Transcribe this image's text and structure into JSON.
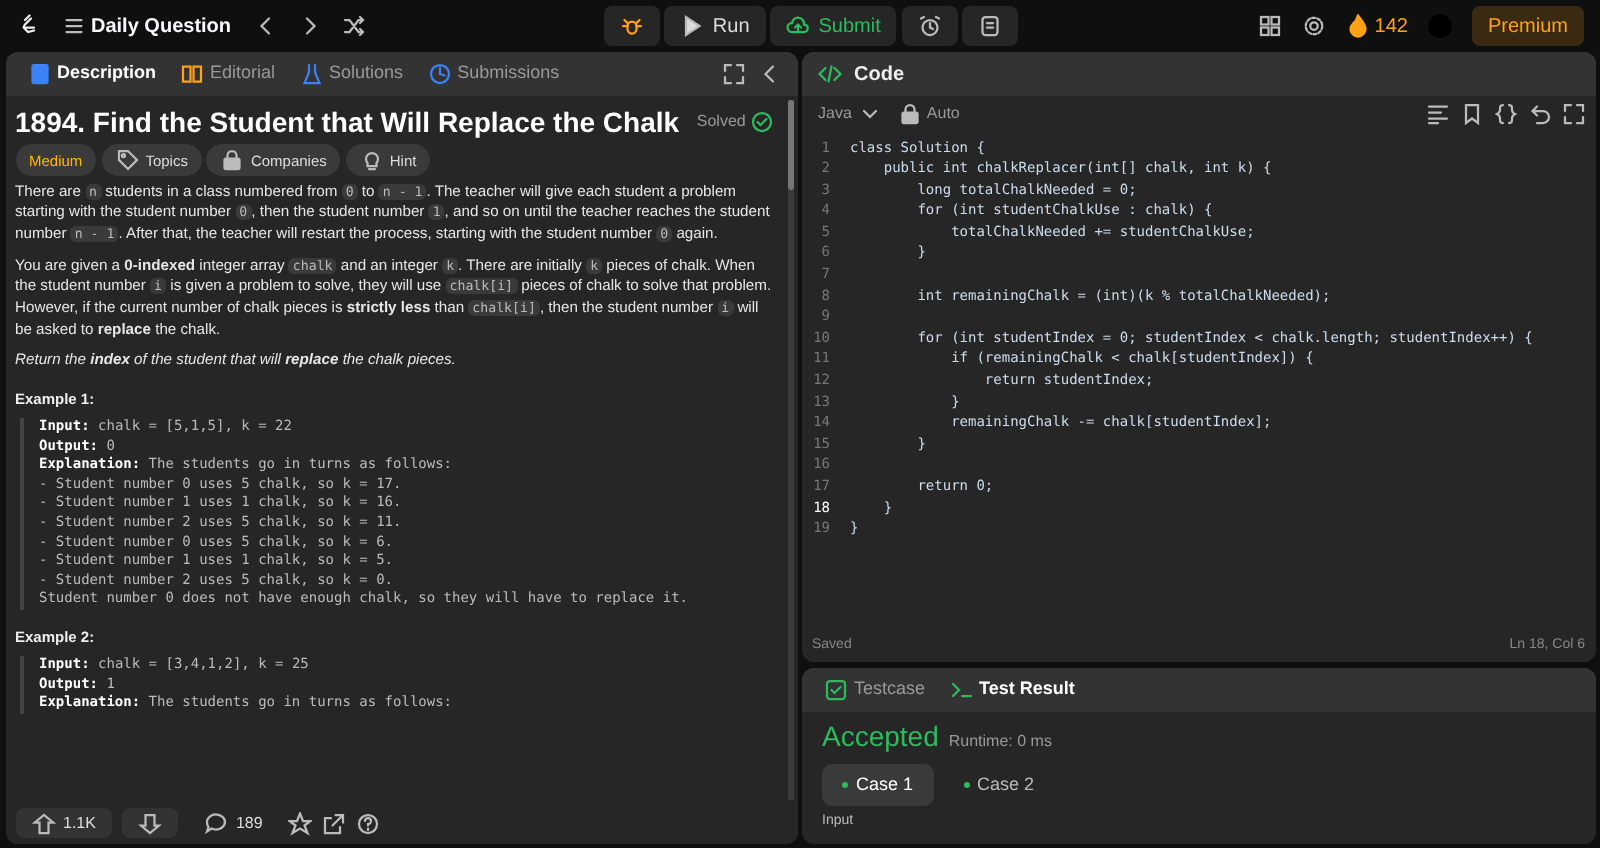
{
  "topbar": {
    "problem_list": "Daily Question",
    "run": "Run",
    "submit": "Submit",
    "streak": "142",
    "premium": "Premium"
  },
  "description_panel": {
    "tabs": [
      {
        "label": "Description",
        "selected": true
      },
      {
        "label": "Editorial",
        "selected": false
      },
      {
        "label": "Solutions",
        "selected": false
      },
      {
        "label": "Submissions",
        "selected": false
      }
    ],
    "title": "1894. Find the Student that Will Replace the Chalk",
    "status": "Solved",
    "tags": [
      {
        "label": "Medium",
        "kind": "difficulty"
      },
      {
        "label": "Topics",
        "kind": "topics"
      },
      {
        "label": "Companies",
        "kind": "companies"
      },
      {
        "label": "Hint",
        "kind": "hint"
      }
    ],
    "paragraphs": [
      [
        {
          "kind": "text",
          "text": "There are "
        },
        {
          "kind": "code",
          "text": "n"
        },
        {
          "kind": "text",
          "text": " students in a class numbered from "
        },
        {
          "kind": "code",
          "text": "0"
        },
        {
          "kind": "text",
          "text": " to "
        },
        {
          "kind": "code",
          "text": "n - 1"
        },
        {
          "kind": "text",
          "text": ". The teacher will give each student a problem starting with the student number "
        },
        {
          "kind": "code",
          "text": "0"
        },
        {
          "kind": "text",
          "text": ", then the student number "
        },
        {
          "kind": "code",
          "text": "1"
        },
        {
          "kind": "text",
          "text": ", and so on until the teacher reaches the student number "
        },
        {
          "kind": "code",
          "text": "n - 1"
        },
        {
          "kind": "text",
          "text": ". After that, the teacher will restart the process, starting with the student number "
        },
        {
          "kind": "code",
          "text": "0"
        },
        {
          "kind": "text",
          "text": " again."
        }
      ],
      [
        {
          "kind": "text",
          "text": "You are given a "
        },
        {
          "kind": "bold",
          "text": "0-indexed"
        },
        {
          "kind": "text",
          "text": " integer array "
        },
        {
          "kind": "code",
          "text": "chalk"
        },
        {
          "kind": "text",
          "text": " and an integer "
        },
        {
          "kind": "code",
          "text": "k"
        },
        {
          "kind": "text",
          "text": ". There are initially "
        },
        {
          "kind": "code",
          "text": "k"
        },
        {
          "kind": "text",
          "text": " pieces of chalk. When the student number "
        },
        {
          "kind": "code",
          "text": "i"
        },
        {
          "kind": "text",
          "text": " is given a problem to solve, they will use "
        },
        {
          "kind": "code",
          "text": "chalk[i]"
        },
        {
          "kind": "text",
          "text": " pieces of chalk to solve that problem. However, if the current number of chalk pieces is "
        },
        {
          "kind": "bold",
          "text": "strictly less"
        },
        {
          "kind": "text",
          "text": " than "
        },
        {
          "kind": "code",
          "text": "chalk[i]"
        },
        {
          "kind": "text",
          "text": ", then the student number "
        },
        {
          "kind": "code",
          "text": "i"
        },
        {
          "kind": "text",
          "text": " will be asked to "
        },
        {
          "kind": "bold",
          "text": "replace"
        },
        {
          "kind": "text",
          "text": " the chalk."
        }
      ],
      [
        {
          "kind": "italic",
          "text": "Return the "
        },
        {
          "kind": "bolditalic",
          "text": "index"
        },
        {
          "kind": "italic",
          "text": " of the student that will "
        },
        {
          "kind": "bolditalic",
          "text": "replace"
        },
        {
          "kind": "italic",
          "text": " the chalk pieces."
        }
      ]
    ],
    "examples": [
      {
        "heading": "Example 1:",
        "lines": [
          "**Input:** chalk = [5,1,5], k = 22",
          "**Output:** 0",
          "**Explanation:** The students go in turns as follows:",
          "- Student number 0 uses 5 chalk, so k = 17.",
          "- Student number 1 uses 1 chalk, so k = 16.",
          "- Student number 2 uses 5 chalk, so k = 11.",
          "- Student number 0 uses 5 chalk, so k = 6.",
          "- Student number 1 uses 1 chalk, so k = 5.",
          "- Student number 2 uses 5 chalk, so k = 0.",
          "Student number 0 does not have enough chalk, so they will have to replace it."
        ]
      },
      {
        "heading": "Example 2:",
        "lines": [
          "**Input:** chalk = [3,4,1,2], k = 25",
          "**Output:** 1",
          "**Explanation:** The students go in turns as follows:"
        ]
      }
    ],
    "footer": {
      "likes": "1.1K",
      "comments": "189"
    }
  },
  "code_panel": {
    "title": "Code",
    "language": "Java",
    "mode": "Auto",
    "lines": [
      {
        "number": "1",
        "text": "class Solution {",
        "current": false
      },
      {
        "number": "2",
        "text": "    public int chalkReplacer(int[] chalk, int k) {",
        "current": false
      },
      {
        "number": "3",
        "text": "        long totalChalkNeeded = 0;",
        "current": false
      },
      {
        "number": "4",
        "text": "        for (int studentChalkUse : chalk) {",
        "current": false
      },
      {
        "number": "5",
        "text": "            totalChalkNeeded += studentChalkUse;",
        "current": false
      },
      {
        "number": "6",
        "text": "        }",
        "current": false
      },
      {
        "number": "7",
        "current": false
      },
      {
        "number": "8",
        "text": "        int remainingChalk = (int)(k % totalChalkNeeded);",
        "current": false
      },
      {
        "number": "9",
        "current": false
      },
      {
        "number": "10",
        "text": "        for (int studentIndex = 0; studentIndex < chalk.length; studentIndex++) {",
        "current": false
      },
      {
        "number": "11",
        "text": "            if (remainingChalk < chalk[studentIndex]) {",
        "current": false
      },
      {
        "number": "12",
        "text": "                return studentIndex;",
        "current": false
      },
      {
        "number": "13",
        "text": "            }",
        "current": false
      },
      {
        "number": "14",
        "text": "            remainingChalk -= chalk[studentIndex];",
        "current": false
      },
      {
        "number": "15",
        "text": "        }",
        "current": false
      },
      {
        "number": "16",
        "current": false
      },
      {
        "number": "17",
        "text": "        return 0;",
        "current": false
      },
      {
        "number": "18",
        "text": "    }",
        "current": true
      },
      {
        "number": "19",
        "text": "}",
        "current": false
      }
    ],
    "status": "Saved",
    "cursor": "Ln 18, Col 6"
  },
  "test_panel": {
    "tabs": [
      {
        "label": "Testcase",
        "selected": false
      },
      {
        "label": "Test Result",
        "selected": true
      }
    ],
    "verdict": "Accepted",
    "runtime": "Runtime: 0 ms",
    "cases": [
      {
        "label": "Case 1",
        "selected": true
      },
      {
        "label": "Case 2",
        "selected": false
      }
    ],
    "input_label": "Input"
  }
}
